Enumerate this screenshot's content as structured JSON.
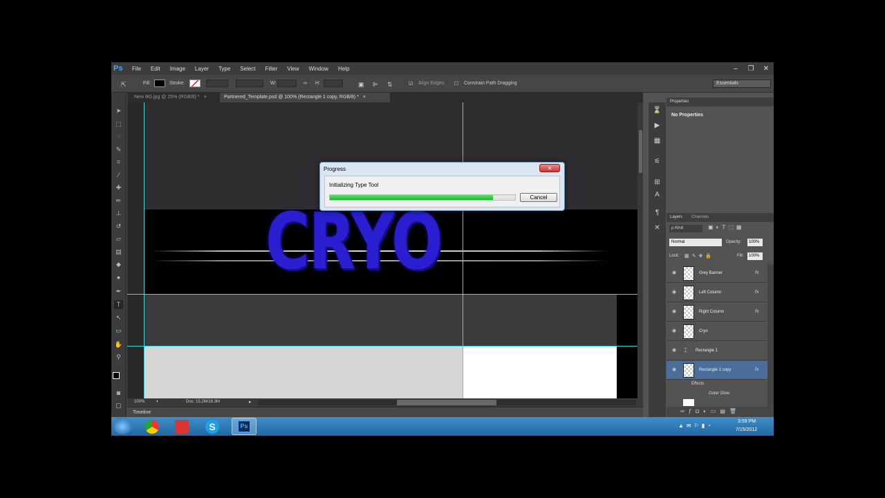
{
  "app": {
    "logo": "Ps",
    "menu": [
      "File",
      "Edit",
      "Image",
      "Layer",
      "Type",
      "Select",
      "Filter",
      "View",
      "Window",
      "Help"
    ],
    "window_controls": {
      "minimize": "–",
      "restore": "❐",
      "close": "✕"
    }
  },
  "options_bar": {
    "fill_label": "Fill:",
    "stroke_label": "Stroke:",
    "w_label": "W:",
    "h_label": "H:",
    "align_edges": "Align Edges",
    "constrain": "Constrain Path Dragging",
    "workspace": "Essentials"
  },
  "tabs": [
    {
      "label": "New BG.jpg @ 25% (RGB/8) *",
      "close": "×",
      "active": false
    },
    {
      "label": "Partnered_Template.psd @ 100% (Rectangle 1 copy, RGB/8) *",
      "close": "×",
      "active": true
    }
  ],
  "canvas": {
    "logo_text": "CRYO"
  },
  "status": {
    "zoom": "100%",
    "doc": "Doc: 15.2M/16.3M"
  },
  "timeline_label": "Timeline",
  "properties": {
    "tab": "Properties",
    "empty": "No Properties"
  },
  "layers_panel": {
    "tabs": [
      "Layers",
      "Channels"
    ],
    "kind": "ρ Kind",
    "blend": "Normal",
    "opacity_label": "Opacity:",
    "opacity": "100%",
    "lock_label": "Lock:",
    "fill_label": "Fill:",
    "fill": "100%",
    "layers": [
      {
        "name": "Grey Banner",
        "fx": "fx",
        "selected": false
      },
      {
        "name": "Left Column",
        "fx": "fx",
        "selected": false
      },
      {
        "name": "Right Column",
        "fx": "fx",
        "selected": false
      },
      {
        "name": "Cryo",
        "fx": "",
        "selected": false
      },
      {
        "name": "Rectangle 1",
        "fx": "",
        "selected": false
      },
      {
        "name": "Rectangle 1 copy",
        "fx": "fx",
        "selected": true
      }
    ],
    "effects_label": "Effects",
    "outer_glow": "Outer Glow"
  },
  "dialog": {
    "title": "Progress",
    "message": "Initializing Type Tool",
    "progress": 0.88,
    "button": "Cancel",
    "close": "✕"
  },
  "taskbar": {
    "time": "3:59 PM",
    "date": "7/15/2012",
    "apps": [
      "start",
      "chrome",
      "office",
      "skype",
      "photoshop"
    ],
    "ps_label": "Ps"
  },
  "colors": {
    "accent": "#4aa8ff",
    "selection": "#4a6e99",
    "cryo": "#2a1fd0",
    "progress": "#14c02e"
  }
}
